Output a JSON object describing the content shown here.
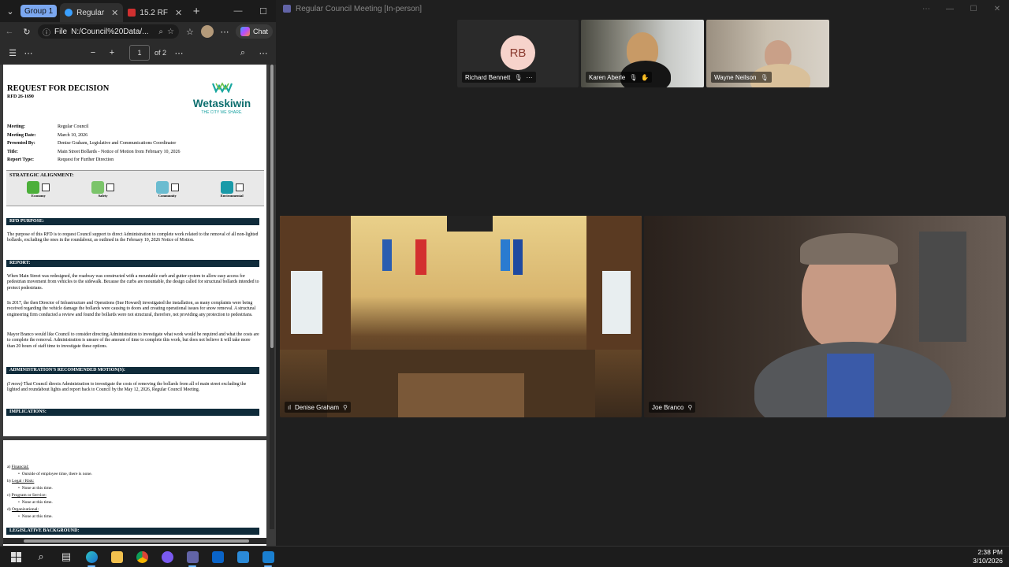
{
  "browser": {
    "tab_group_label": "Group 1",
    "tabs": [
      {
        "label": "Regular"
      },
      {
        "label": "15.2 RF"
      }
    ],
    "address": {
      "scheme": "File",
      "url": "N:/Council%20Data/..."
    },
    "chat_label": "Chat",
    "pdf": {
      "page_current": "1",
      "page_total": "of 2"
    }
  },
  "document": {
    "title": "REQUEST FOR DECISION",
    "number": "RFD 26-1690",
    "logo": {
      "name": "Wetaskiwin",
      "tagline": "THE CITY WE SHARE."
    },
    "meta": [
      {
        "key": "Meeting:",
        "value": "Regular Council"
      },
      {
        "key": "Meeting Date:",
        "value": "March 10, 2026"
      },
      {
        "key": "Presented By:",
        "value": "Denise Graham, Legislative and Communications Coordinator"
      },
      {
        "key": "Title:",
        "value": "Main Street Bollards - Notice of Motion from February 10, 2026"
      },
      {
        "key": "Report Type:",
        "value": "Request for Further Direction"
      }
    ],
    "strategic_heading": "STRATEGIC ALIGNMENT:",
    "strategic_items": [
      "Economy",
      "Safety",
      "Community",
      "Environmental"
    ],
    "purpose_heading": "RFD PURPOSE:",
    "purpose_text": "The purpose of this RFD is to request Council support to direct Administration to complete work related to the removal of all non-lighted bollards, excluding the ones in the roundabout, as outlined in the February 10, 2026 Notice of Motion.",
    "report_heading": "REPORT:",
    "report_paragraphs": [
      "When Main Street was redesigned, the roadway was constructed with a mountable curb and gutter system to allow easy access for pedestrian movement from vehicles to the sidewalk. Because the curbs are mountable, the design called for structural bollards intended to protect pedestrians.",
      "In 2017, the then Director of Infrastructure and Operations (Sue Howard) investigated the installation, as many complaints were being received regarding the vehicle damage the bollards were causing to doors and creating operational issues for snow removal. A structural engineering firm conducted a review and found the bollards were not structural, therefore, not providing any protection to pedestrians.",
      "Mayor Branco would like Council to consider directing Administration to investigate what work would be required and what the costs are to complete the removal. Administration is unsure of the amount of time to complete this work, but does not believe it will take more than 20 hours of staff time to investigate these options."
    ],
    "motion_heading": "ADMINISTRATION'S RECOMMENDED MOTION(S):",
    "motion_mover": "(I move)",
    "motion_text": "That Council directs Administration to investigate the costs of removing the bollards from all of main street excluding the lighted and roundabout lights and report back to Council by the May 12, 2026, Regular Council Meeting.",
    "implications_heading": "IMPLICATIONS:",
    "implications": [
      {
        "label": "a) ",
        "title": "Financial:",
        "bullet": "Outside of employee time, there is none."
      },
      {
        "label": "b) ",
        "title": "Legal / Risk:",
        "bullet": "None at this time."
      },
      {
        "label": "c) ",
        "title": "Program or Service:",
        "bullet": "None at this time."
      },
      {
        "label": "d) ",
        "title": "Organizational:",
        "bullet": "None at this time."
      }
    ],
    "legislative_heading": "LEGISLATIVE BACKGROUND:"
  },
  "teams": {
    "window_title": "Regular Council Meeting [In-person]",
    "participants_top": [
      {
        "name": "Richard Bennett",
        "initials": "RB"
      },
      {
        "name": "Karen Aberle"
      },
      {
        "name": "Wayne Neilson"
      }
    ],
    "participants_main": [
      {
        "name": "Denise Graham"
      },
      {
        "name": "Joe Branco"
      }
    ]
  },
  "taskbar": {
    "time": "2:38 PM",
    "date": "3/10/2026"
  },
  "colors": {
    "accent": "#7ba7f0",
    "doc_bar": "#0f2b3a",
    "logo_teal": "#0d6e6e",
    "teams_purple": "#6264a7",
    "rb_avatar_bg": "#f6d3cb"
  }
}
